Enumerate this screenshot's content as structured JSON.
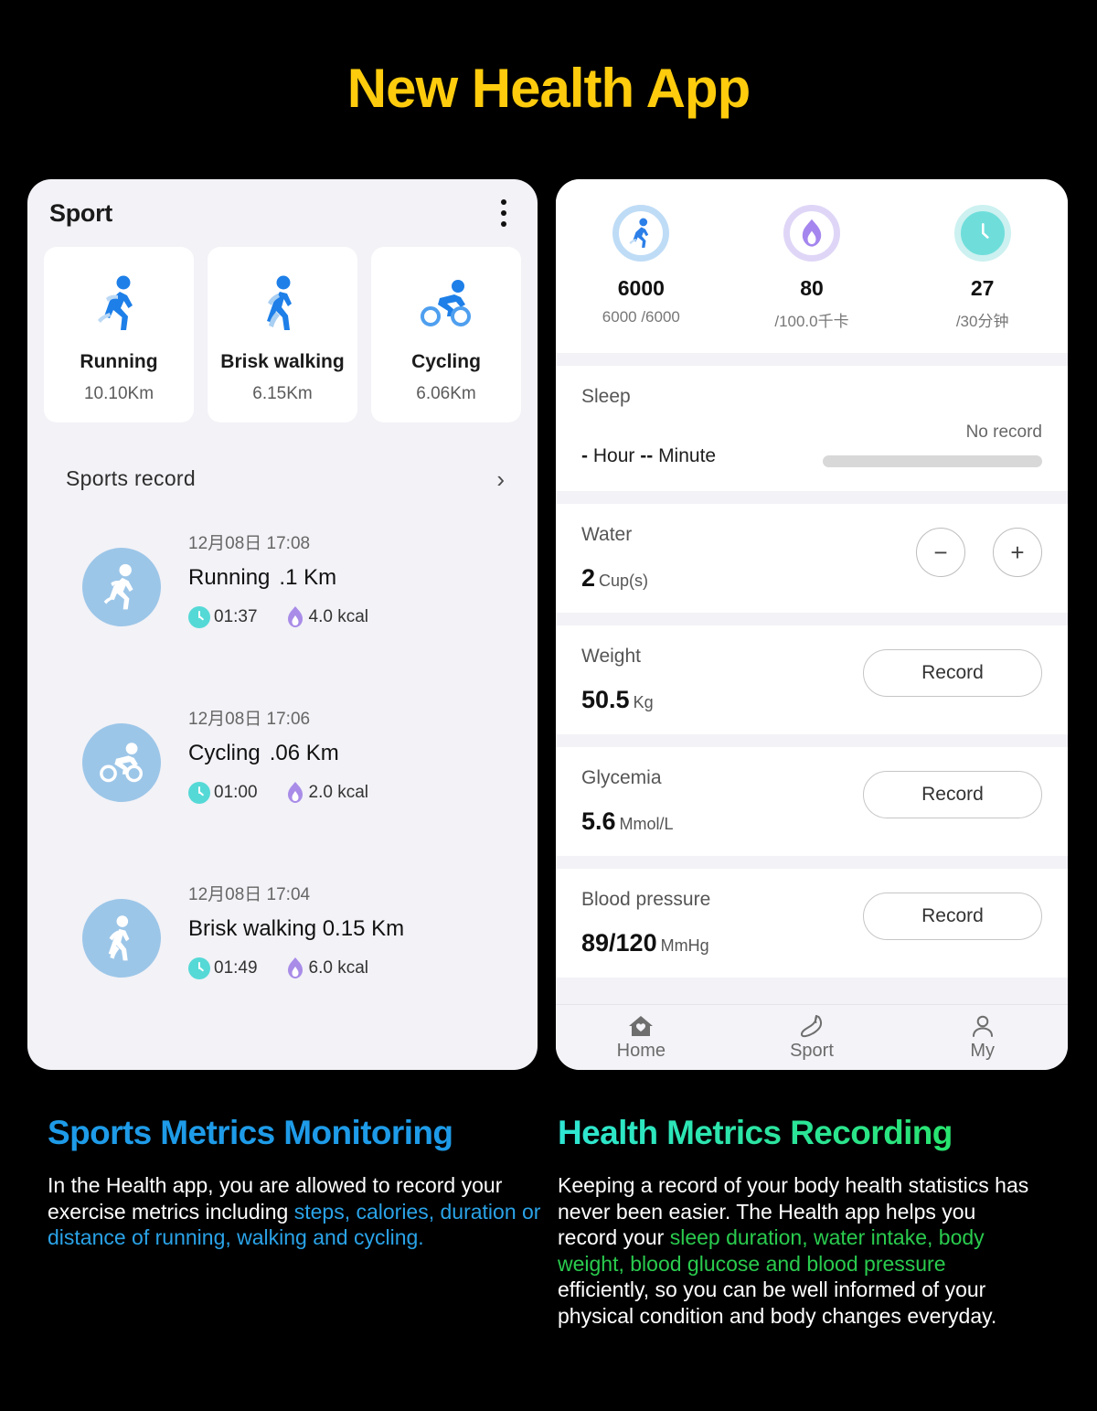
{
  "title": "New Health App",
  "colors": {
    "title": "#FFCC0D",
    "accent_blue": "#1E9BE8",
    "accent_green": "#27E558",
    "accent_cyan": "#2EE6D4",
    "card_bg": "#F2F2F7",
    "icon_blue": "#1E7FE8",
    "avatar_blue": "#9CC6E8",
    "clock_teal": "#55D9D6",
    "flame_purple": "#A98CE8"
  },
  "left_phone": {
    "header": {
      "title": "Sport",
      "menu_icon": "kebab-menu-icon"
    },
    "activity_cards": [
      {
        "icon": "running-icon",
        "name": "Running",
        "distance": "10.10Km"
      },
      {
        "icon": "walking-icon",
        "name": "Brisk walking",
        "distance": "6.15Km"
      },
      {
        "icon": "cycling-icon",
        "name": "Cycling",
        "distance": "6.06Km"
      }
    ],
    "records_section": {
      "label": "Sports record",
      "chevron": "chevron-right-icon"
    },
    "records": [
      {
        "icon": "running-icon",
        "time": "12月08日 17:08",
        "activity": "Running",
        "distance": ".1 Km",
        "duration": "01:37",
        "calories": "4.0 kcal"
      },
      {
        "icon": "cycling-icon",
        "time": "12月08日 17:06",
        "activity": "Cycling",
        "distance": ".06 Km",
        "duration": "01:00",
        "calories": "2.0 kcal"
      },
      {
        "icon": "walking-icon",
        "time": "12月08日 17:04",
        "activity": "Brisk walking 0.15 Km",
        "distance": "",
        "duration": "01:49",
        "calories": "6.0 kcal"
      }
    ]
  },
  "right_phone": {
    "top_metrics": [
      {
        "icon": "running-icon",
        "value": "6000",
        "sub": "6000 /6000"
      },
      {
        "icon": "flame-icon",
        "value": "80",
        "sub": "/100.0千卡"
      },
      {
        "icon": "clock-icon",
        "value": "27",
        "sub": "/30分钟"
      }
    ],
    "sleep": {
      "label": "Sleep",
      "hour_value": "-",
      "hour_unit": "Hour",
      "minute_value": "--",
      "minute_unit": "Minute",
      "status": "No record"
    },
    "water": {
      "label": "Water",
      "value": "2",
      "unit": "Cup(s)",
      "minus_label": "−",
      "plus_label": "+"
    },
    "weight": {
      "label": "Weight",
      "value": "50.5",
      "unit": "Kg",
      "button": "Record"
    },
    "glycemia": {
      "label": "Glycemia",
      "value": "5.6",
      "unit": "Mmol/L",
      "button": "Record"
    },
    "blood_pressure": {
      "label": "Blood pressure",
      "value": "89/120",
      "unit": "MmHg",
      "button": "Record"
    },
    "nav": [
      {
        "icon": "home-heart-icon",
        "label": "Home",
        "active": true
      },
      {
        "icon": "shoe-icon",
        "label": "Sport",
        "active": false
      },
      {
        "icon": "person-icon",
        "label": "My",
        "active": false
      }
    ]
  },
  "blurbs": {
    "left": {
      "heading": "Sports Metrics Monitoring",
      "body_part1": "In the Health app, you are allowed to record your exercise metrics including ",
      "body_highlight": "steps, calories, duration or distance of running, walking and cycling.",
      "body_part2": ""
    },
    "right": {
      "heading": "Health Metrics Recording",
      "body_part1": "Keeping a record of your body health statistics has never been easier. The Health app helps you record your ",
      "body_highlight": "sleep duration, water intake, body weight, blood glucose and blood pressure",
      "body_part2": " efficiently, so you can be well informed of your physical condition and body changes everyday."
    }
  }
}
